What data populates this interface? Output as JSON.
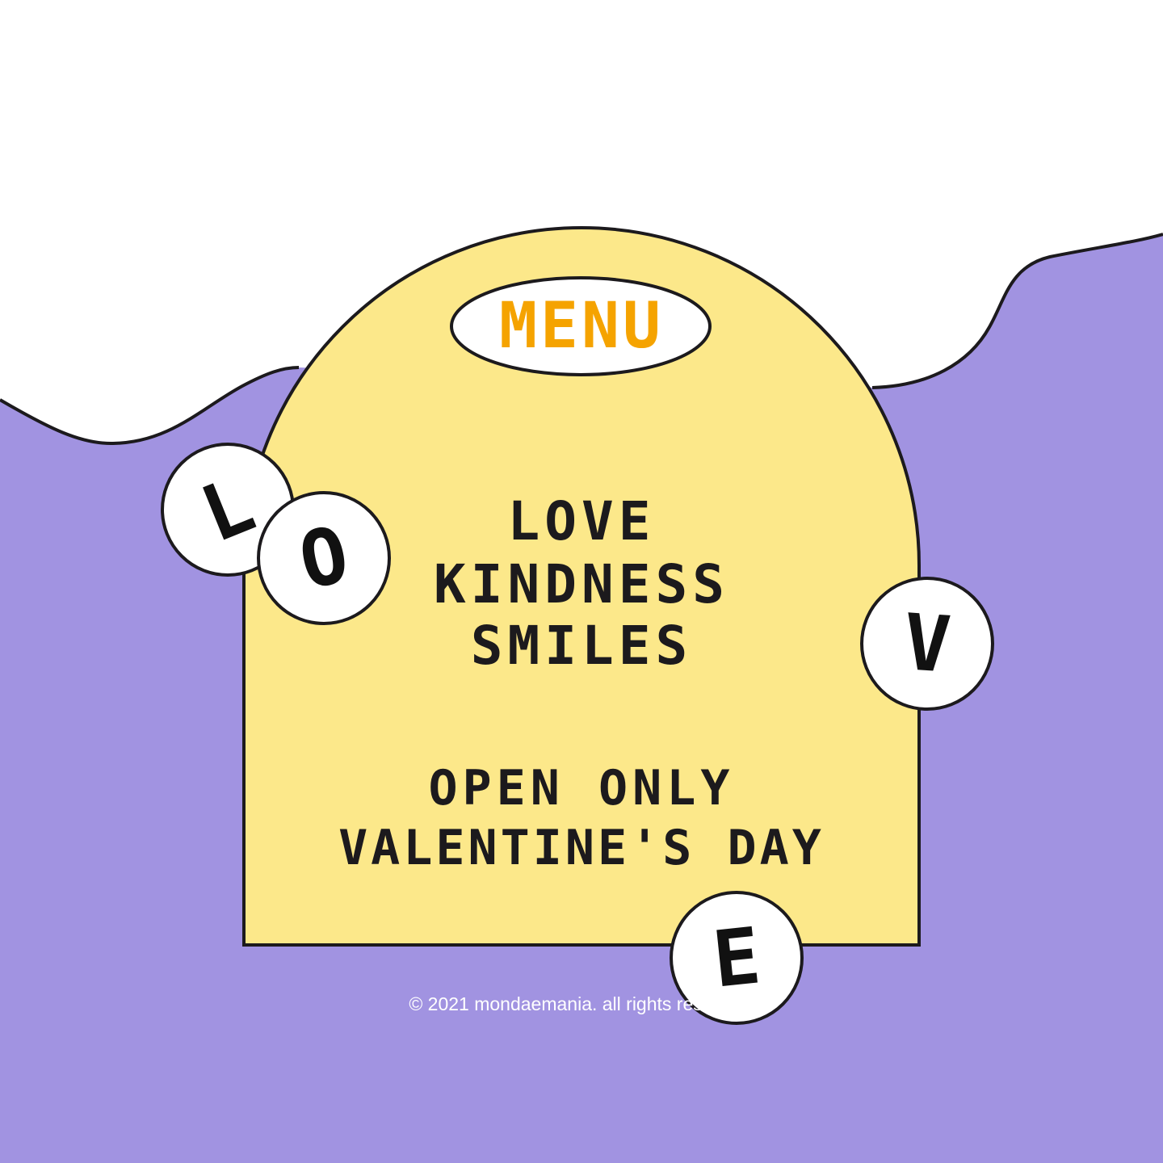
{
  "colors": {
    "purple": "#a193e1",
    "yellow": "#fce88a",
    "orange": "#f5a300",
    "outline": "#1c1a1d",
    "white": "#ffffff"
  },
  "menu_badge": {
    "label": "MENU"
  },
  "menu_items": {
    "line1": "LOVE",
    "line2": "KINDNESS",
    "line3": "SMILES"
  },
  "notice": {
    "line1": "OPEN ONLY",
    "line2": "VALENTINE'S DAY"
  },
  "bubbles": {
    "l": "L",
    "o": "O",
    "v": "V",
    "e": "E"
  },
  "footer": {
    "copyright": "© 2021 mondaemania. all rights reserved."
  }
}
